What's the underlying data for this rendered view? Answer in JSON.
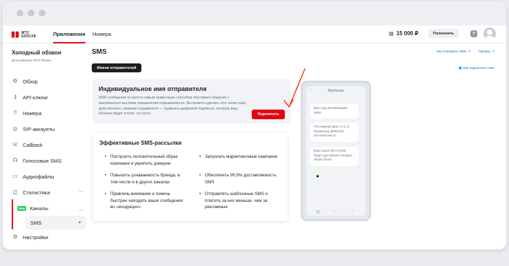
{
  "topnav": {
    "logo_mark": "МТС",
    "logo_text_line1": "МТС",
    "logo_text_line2": "EXOLVE",
    "apps": "Приложения",
    "numbers": "Номера",
    "balance": "15 000 ₽",
    "topup": "Пополнить",
    "help": "?"
  },
  "sidebar": {
    "project_title": "Холодный обзвон",
    "project_sub": "Для компании ООО Феникс",
    "items": [
      {
        "label": "Обзор",
        "icon": "overview-icon"
      },
      {
        "label": "API-ключи",
        "icon": "key-icon"
      },
      {
        "label": "Номера",
        "icon": "dialpad-icon"
      },
      {
        "label": "SIP-аккаунты",
        "icon": "sip-icon"
      },
      {
        "label": "Callback",
        "icon": "callback-icon"
      },
      {
        "label": "Голосовые SMS",
        "icon": "voice-sms-icon"
      },
      {
        "label": "Аудиофайлы",
        "icon": "audio-file-icon"
      },
      {
        "label": "Статистика",
        "icon": "stats-icon"
      },
      {
        "label": "Каналы",
        "icon": "channels-icon",
        "badge": "New"
      },
      {
        "label": "SMS"
      },
      {
        "label": "Настройки",
        "icon": "settings-icon"
      }
    ]
  },
  "main": {
    "title": "SMS",
    "link_how_send": "Как отправить SMS",
    "link_tariffs": "Тарифы",
    "link_how_connect_name": "Как подключить имя",
    "sender_names_button": "Имена отправителей",
    "card1": {
      "title": "Индивидуальное имя отправителя",
      "text": "SMS-сообщения остаются самым привычным способом текстового общения с максимально высоким показателем открываемости. Вы можете сделать этот канал ещё действеннее с именем отправителя — буквенно-цифровой подписью, которую ваш абонент видит в поле «от кого»",
      "button": "Подключить"
    },
    "card2": {
      "title": "Эффективные SMS-рассылки",
      "bullets": [
        "Построить положительный образ компании и укрепить доверие",
        "Запускать маркетинговые кампании",
        "Повысить узнаваемость бренда, в том числе и в других каналах",
        "Обеспечить 99,9% доставляемость SMS",
        "Привлечь внимание и помочь быстрее находить ваши сообщения во «входящих»",
        "Отправлять шаблонные SMS и платить за них меньше, чем за рекламные"
      ]
    }
  },
  "phone": {
    "back": "‹",
    "sender": "MyHouse",
    "messages": [
      [
        "Ваш код авторизации:",
        "4062"
      ],
      [
        "Последний день 1+1=3",
        "Промокод 3PRICE2.",
        "На myhouse.ru"
      ],
      [
        "Ваш заказ МН-01234",
        "будет доставлен сегодня",
        "09:00-18:00"
      ]
    ],
    "nav": [
      "▥",
      "○",
      "‹"
    ]
  },
  "colors": {
    "accent": "#e30611",
    "link": "#0070e5",
    "success": "#26cd58"
  }
}
